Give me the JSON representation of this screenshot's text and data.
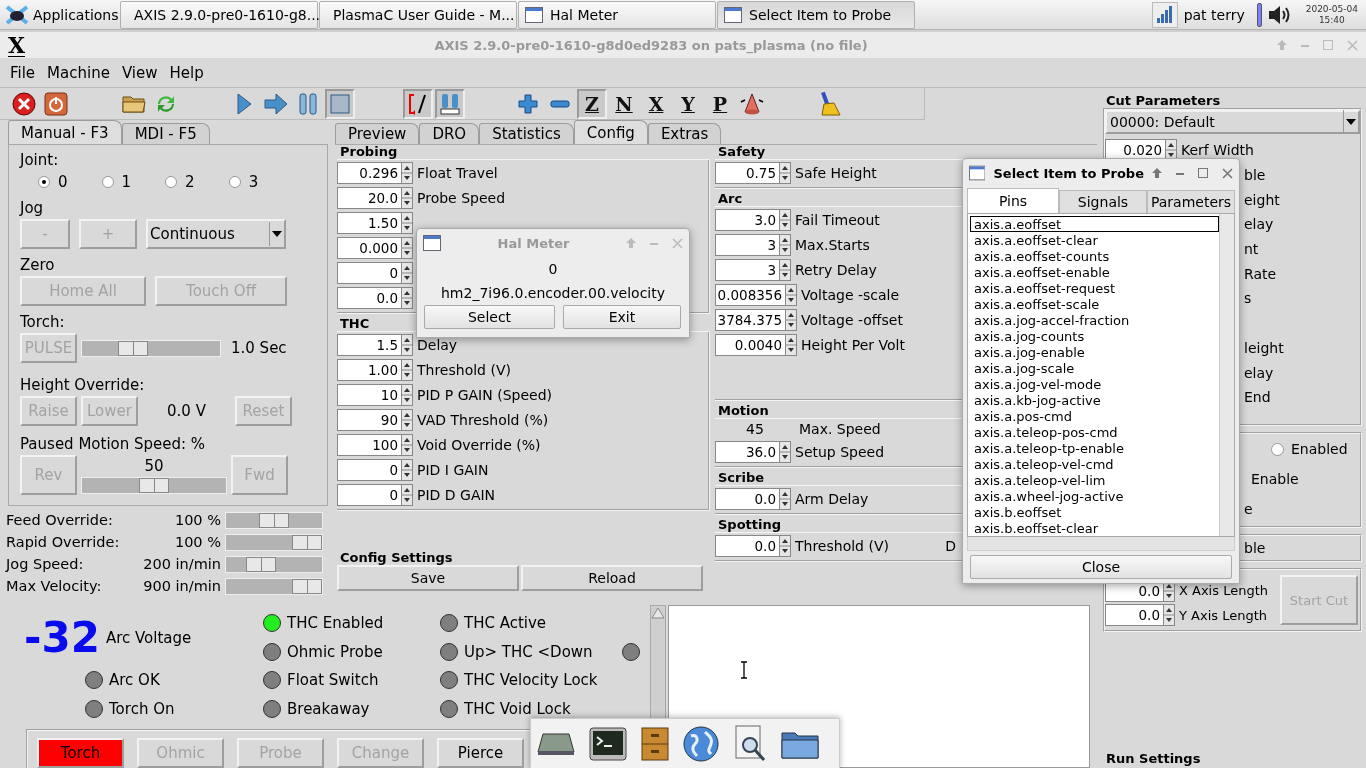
{
  "taskbar": {
    "apps_label": "Applications",
    "tasks": [
      {
        "label": "AXIS 2.9.0-pre0-1610-g8...",
        "kind": "x",
        "selected": false
      },
      {
        "label": "PlasmaC User Guide - M...",
        "kind": "browser",
        "selected": false
      },
      {
        "label": "Hal Meter",
        "kind": "window",
        "selected": false
      },
      {
        "label": "Select Item to Probe",
        "kind": "window",
        "selected": true
      }
    ],
    "user": "pat terry",
    "date": "2020-05-04",
    "time": "15:40"
  },
  "window": {
    "icon": "X",
    "title": "AXIS 2.9.0-pre0-1610-g8d0ed9283 on pats_plasma (no file)"
  },
  "menu": [
    "File",
    "Machine",
    "View",
    "Help"
  ],
  "toolbar": [
    [
      {
        "kind": "estop",
        "pressed": false
      },
      {
        "kind": "power",
        "pressed": false
      }
    ],
    [
      {
        "kind": "open",
        "pressed": false
      },
      {
        "kind": "reload",
        "pressed": false
      }
    ],
    [
      {
        "kind": "run",
        "pressed": false
      },
      {
        "kind": "step",
        "pressed": false
      },
      {
        "kind": "pause",
        "pressed": false
      },
      {
        "kind": "stop",
        "pressed": true
      }
    ],
    [
      {
        "kind": "blockdelete",
        "pressed": true
      },
      {
        "kind": "optstop",
        "pressed": true
      }
    ],
    [
      {
        "kind": "zoomin",
        "pressed": false
      },
      {
        "kind": "zoomout",
        "pressed": false
      },
      {
        "kind": "view",
        "label": "Z",
        "pressed": true
      },
      {
        "kind": "view",
        "label": "N",
        "pressed": false
      },
      {
        "kind": "view",
        "label": "X",
        "pressed": false
      },
      {
        "kind": "view",
        "label": "Y",
        "pressed": false
      },
      {
        "kind": "view",
        "label": "P",
        "pressed": false
      },
      {
        "kind": "cone",
        "pressed": false
      }
    ],
    [
      {
        "kind": "brush",
        "pressed": false
      }
    ]
  ],
  "left_tabs": [
    {
      "label": "Manual - F3",
      "selected": true
    },
    {
      "label": "MDI - F5",
      "selected": false
    }
  ],
  "manual": {
    "joint_label": "Joint:",
    "joints": [
      {
        "label": "0",
        "selected": true
      },
      {
        "label": "1",
        "selected": false
      },
      {
        "label": "2",
        "selected": false
      },
      {
        "label": "3",
        "selected": false
      }
    ],
    "jog_label": "Jog",
    "jog_buttons": [
      {
        "label": "-",
        "disabled": true
      },
      {
        "label": "+",
        "disabled": true
      }
    ],
    "jog_mode": "Continuous",
    "zero_label": "Zero",
    "zero_buttons": [
      {
        "label": "Home All",
        "disabled": true
      },
      {
        "label": "Touch Off",
        "disabled": true
      }
    ],
    "torch_label": "Torch:",
    "pulse_button": {
      "label": "PULSE",
      "disabled": true
    },
    "pulse_slider": {
      "level": 0.33
    },
    "pulse_reading": "1.0 Sec",
    "height_label": "Height Override:",
    "raise": {
      "label": "Raise",
      "disabled": true
    },
    "lower": {
      "label": "Lower",
      "disabled": true
    },
    "height_reading": "0.0 V",
    "reset": {
      "label": "Reset",
      "disabled": true
    },
    "paused_label": "Paused Motion Speed: %",
    "rev": {
      "label": "Rev",
      "disabled": true
    },
    "paused_value": "50",
    "paused_slider": {
      "level": 0.5
    },
    "fwd": {
      "label": "Fwd",
      "disabled": true
    }
  },
  "overrides": [
    {
      "label": "Feed Override:",
      "reading": "100 %",
      "level": 0.5
    },
    {
      "label": "Rapid Override:",
      "reading": "100 %",
      "level": 1.0
    },
    {
      "label": "Jog Speed:",
      "reading": "200 in/min",
      "level": 0.31
    },
    {
      "label": "Max Velocity:",
      "reading": "900 in/min",
      "level": 1.0
    }
  ],
  "center_tabs": [
    {
      "label": "Preview",
      "selected": false
    },
    {
      "label": "DRO",
      "selected": false
    },
    {
      "label": "Statistics",
      "selected": false
    },
    {
      "label": "Config",
      "selected": true
    },
    {
      "label": "Extras",
      "selected": false
    }
  ],
  "config": {
    "probing": {
      "title": "Probing",
      "rows": [
        {
          "value": "0.296",
          "label": "Float Travel"
        },
        {
          "value": "20.0",
          "label": "Probe Speed"
        },
        {
          "value": "1.50"
        },
        {
          "value": "0.000"
        },
        {
          "value": "0"
        },
        {
          "value": "0.0"
        }
      ]
    },
    "thc": {
      "title": "THC",
      "rows": [
        {
          "value": "1.5",
          "label": "Delay"
        },
        {
          "value": "1.00",
          "label": "Threshold (V)"
        },
        {
          "value": "10",
          "label": "PID P GAIN (Speed)"
        },
        {
          "value": "90",
          "label": "VAD Threshold (%)"
        },
        {
          "value": "100",
          "label": "Void Override (%)"
        },
        {
          "value": "0",
          "label": "PID I GAIN"
        },
        {
          "value": "0",
          "label": "PID D GAIN"
        }
      ]
    },
    "settings": {
      "title": "Config Settings",
      "buttons": [
        "Save",
        "Reload"
      ]
    },
    "safety": {
      "title": "Safety",
      "rows": [
        {
          "value": "0.75",
          "label": "Safe Height"
        }
      ]
    },
    "arc": {
      "title": "Arc",
      "rows": [
        {
          "value": "3.0",
          "label": "Fail Timeout"
        },
        {
          "value": "3",
          "label": "Max.Starts"
        },
        {
          "value": "3",
          "label": "Retry Delay"
        },
        {
          "value": "0.008356",
          "label": "Voltage -scale"
        },
        {
          "value": "3784.375",
          "label": "Voltage -offset"
        },
        {
          "value": "0.0040",
          "label": "Height Per Volt"
        }
      ]
    },
    "motion": {
      "title": "Motion",
      "max_value": "45",
      "max_label": "Max. Speed",
      "rows": [
        {
          "value": "36.0",
          "label": "Setup Speed"
        }
      ]
    },
    "scribe": {
      "title": "Scribe",
      "rows": [
        {
          "value": "0.0",
          "label": "Arm Delay"
        }
      ]
    },
    "spotting": {
      "title": "Spotting",
      "rows": [
        {
          "value": "0.0",
          "label": "Threshold (V)"
        }
      ],
      "fragment": "D"
    }
  },
  "cut_parameters": {
    "title": "Cut Parameters",
    "material": "00000: Default",
    "rows": [
      {
        "kind": "spin",
        "value": "0.020",
        "label": "Kerf Width"
      },
      {
        "kind": "fragment",
        "label": "ble"
      },
      {
        "kind": "fragment",
        "label": "eight"
      },
      {
        "kind": "fragment",
        "label": "elay"
      },
      {
        "kind": "fragment",
        "label": "nt"
      },
      {
        "kind": "fragment",
        "label": "Rate"
      },
      {
        "kind": "fragment",
        "label": "s"
      },
      {
        "kind": "blank"
      },
      {
        "kind": "fragment",
        "label": "leight"
      },
      {
        "kind": "fragment",
        "label": "elay"
      },
      {
        "kind": "fragment",
        "label": "End"
      }
    ],
    "options": [
      {
        "kind": "radio",
        "label": "Enabled",
        "checked": false
      },
      {
        "kind": "fragment",
        "label": "Enable"
      },
      {
        "kind": "fragment",
        "label": "e"
      }
    ],
    "more": [
      {
        "kind": "fragment",
        "label": "ble"
      }
    ],
    "lengths": [
      {
        "value": "0.0",
        "label": "X Axis Length"
      },
      {
        "value": "0.0",
        "label": "Y Axis Length"
      }
    ],
    "start_cut": {
      "label": "Start Cut",
      "disabled": true
    }
  },
  "run_settings": {
    "title": "Run Settings"
  },
  "status": {
    "voltage": "-32",
    "voltage_label": "Arc Voltage",
    "col1": [
      {
        "label": "Arc OK",
        "on": false
      },
      {
        "label": "Torch On",
        "on": false
      }
    ],
    "col2": [
      {
        "label": "THC Enabled",
        "on": true
      },
      {
        "label": "Ohmic Probe",
        "on": false
      },
      {
        "label": "Float Switch",
        "on": false
      },
      {
        "label": "Breakaway",
        "on": false
      }
    ],
    "col3": [
      {
        "label": "THC Active",
        "on": false
      },
      {
        "label": "Up> THC <Down",
        "on": false,
        "down_on": false
      },
      {
        "label": "THC Velocity Lock",
        "on": false
      },
      {
        "label": "THC Void Lock",
        "on": false
      }
    ],
    "buttons": [
      {
        "label": "Torch",
        "active": true,
        "disabled": false
      },
      {
        "label": "Ohmic",
        "active": false,
        "disabled": true
      },
      {
        "label": "Probe",
        "active": false,
        "disabled": true
      },
      {
        "label": "Change",
        "active": false,
        "disabled": true
      },
      {
        "label": "Pierce",
        "active": false,
        "disabled": false
      }
    ]
  },
  "hal_meter": {
    "title": "Hal Meter",
    "value": "0",
    "pin": "hm2_7i96.0.encoder.00.velocity",
    "buttons": [
      "Select",
      "Exit"
    ]
  },
  "probe_dialog": {
    "title": "Select Item to Probe",
    "tabs": [
      {
        "label": "Pins",
        "selected": true
      },
      {
        "label": "Signals",
        "selected": false
      },
      {
        "label": "Parameters",
        "selected": false
      }
    ],
    "items": [
      {
        "label": "axis.a.eoffset",
        "selected": true
      },
      {
        "label": "axis.a.eoffset-clear",
        "selected": false
      },
      {
        "label": "axis.a.eoffset-counts",
        "selected": false
      },
      {
        "label": "axis.a.eoffset-enable",
        "selected": false
      },
      {
        "label": "axis.a.eoffset-request",
        "selected": false
      },
      {
        "label": "axis.a.eoffset-scale",
        "selected": false
      },
      {
        "label": "axis.a.jog-accel-fraction",
        "selected": false
      },
      {
        "label": "axis.a.jog-counts",
        "selected": false
      },
      {
        "label": "axis.a.jog-enable",
        "selected": false
      },
      {
        "label": "axis.a.jog-scale",
        "selected": false
      },
      {
        "label": "axis.a.jog-vel-mode",
        "selected": false
      },
      {
        "label": "axis.a.kb-jog-active",
        "selected": false
      },
      {
        "label": "axis.a.pos-cmd",
        "selected": false
      },
      {
        "label": "axis.a.teleop-pos-cmd",
        "selected": false
      },
      {
        "label": "axis.a.teleop-tp-enable",
        "selected": false
      },
      {
        "label": "axis.a.teleop-vel-cmd",
        "selected": false
      },
      {
        "label": "axis.a.teleop-vel-lim",
        "selected": false
      },
      {
        "label": "axis.a.wheel-jog-active",
        "selected": false
      },
      {
        "label": "axis.b.eoffset",
        "selected": false
      },
      {
        "label": "axis.b.eoffset-clear",
        "selected": false
      }
    ],
    "close": "Close"
  },
  "dock": [
    {
      "kind": "drive"
    },
    {
      "kind": "terminal"
    },
    {
      "kind": "cabinet"
    },
    {
      "kind": "globe"
    },
    {
      "kind": "search"
    },
    {
      "kind": "folder"
    }
  ]
}
